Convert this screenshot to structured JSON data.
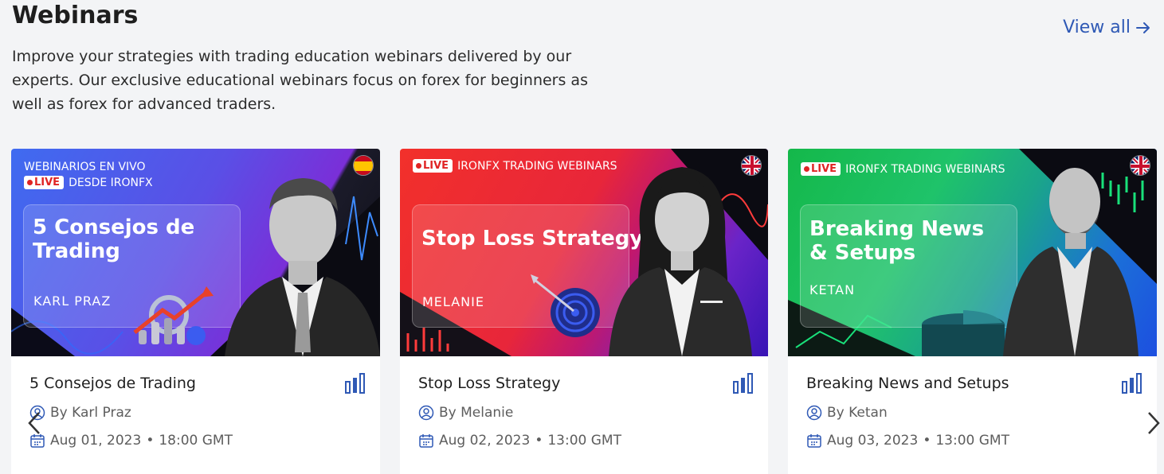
{
  "section": {
    "title": "Webinars",
    "view_all": "View all",
    "description": "Improve your strategies with trading education webinars delivered by our experts. Our exclusive educational webinars focus on forex for beginners as well as forex for advanced traders."
  },
  "cards": [
    {
      "banner_header_line1": "WEBINARIOS EN VIVO",
      "banner_live": "LIVE",
      "banner_header_line2": "DESDE IRONFX",
      "banner_title": "5 Consejos de Trading",
      "banner_speaker": "KARL PRAZ",
      "flag": "spain-flag",
      "title": "5 Consejos de Trading",
      "author": "By Karl Praz",
      "date": "Aug 01, 2023",
      "time": "18:00 GMT"
    },
    {
      "banner_live": "LIVE",
      "banner_header": "IRONFX TRADING WEBINARS",
      "banner_title": "Stop Loss Strategy",
      "banner_speaker": "MELANIE",
      "flag": "uk-flag",
      "title": "Stop Loss Strategy",
      "author": "By Melanie",
      "date": "Aug 02, 2023",
      "time": "13:00 GMT"
    },
    {
      "banner_live": "LIVE",
      "banner_header": "IRONFX TRADING WEBINARS",
      "banner_title": "Breaking News & Setups",
      "banner_speaker": "KETAN",
      "flag": "uk-flag",
      "title": "Breaking News and Setups",
      "author": "By Ketan",
      "date": "Aug 03, 2023",
      "time": "13:00 GMT"
    }
  ],
  "separator": "•",
  "colors": {
    "accent": "#2f59b5",
    "live_red": "#e02424",
    "background": "#f3f4f6"
  }
}
